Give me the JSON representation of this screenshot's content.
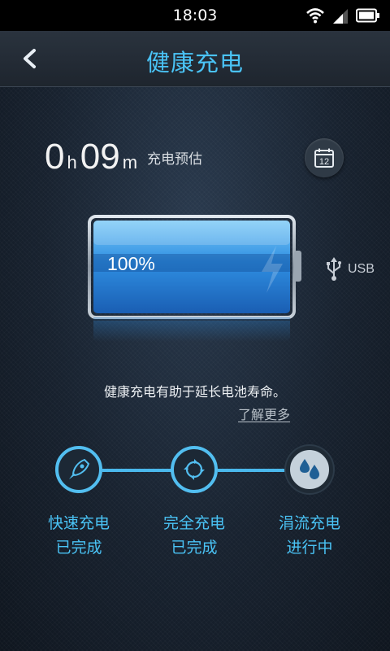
{
  "status_bar": {
    "time": "18:03"
  },
  "header": {
    "title": "健康充电"
  },
  "estimate": {
    "hours": "0",
    "hours_unit": "h",
    "minutes": "09",
    "minutes_unit": "m",
    "label": "充电预估"
  },
  "calendar": {
    "day": "12"
  },
  "battery": {
    "percent": "100%",
    "level": 1.0,
    "source": "USB"
  },
  "info": {
    "tip": "健康充电有助于延长电池寿命。",
    "learn_more": "了解更多"
  },
  "steps": [
    {
      "line1": "快速充电",
      "line2": "已完成"
    },
    {
      "line1": "完全充电",
      "line2": "已完成"
    },
    {
      "line1": "涓流充电",
      "line2": "进行中"
    }
  ],
  "colors": {
    "accent": "#4ac3f5",
    "battery_fill": "#2c8fe0"
  }
}
